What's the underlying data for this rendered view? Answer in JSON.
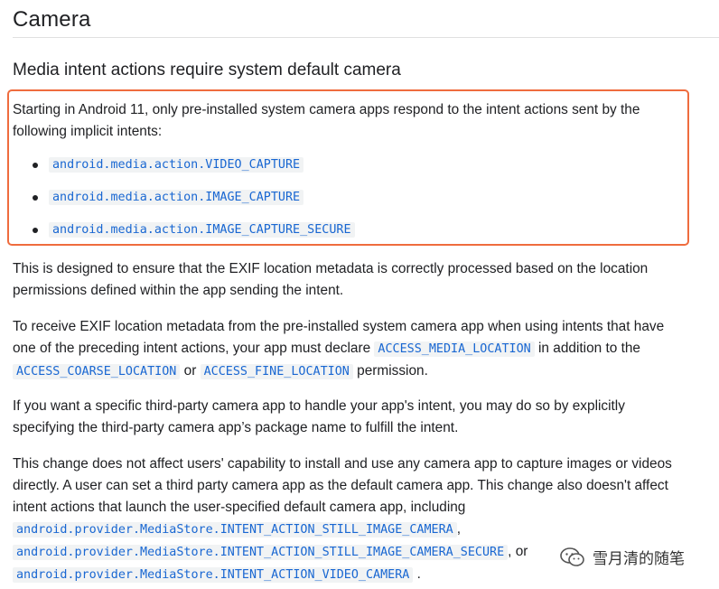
{
  "page_title": "Camera",
  "section_heading": "Media intent actions require system default camera",
  "intro": "Starting in Android 11, only pre-installed system camera apps respond to the intent actions sent by the",
  "intro_line2": "following implicit intents:",
  "intent_list": [
    "android.media.action.VIDEO_CAPTURE",
    "android.media.action.IMAGE_CAPTURE",
    "android.media.action.IMAGE_CAPTURE_SECURE"
  ],
  "p_exif": {
    "line1": "This is designed to ensure that the EXIF location metadata is correctly processed based on the location",
    "line2": "permissions defined within the app sending the intent."
  },
  "p_receive": {
    "line1": "To receive EXIF location metadata from the pre-installed system camera app when using intents that have",
    "line2_pre": "one of the preceding intent actions, your app must declare",
    "code_media_location": "ACCESS_MEDIA_LOCATION",
    "line2_post": "in addition to the",
    "code_coarse": "ACCESS_COARSE_LOCATION",
    "or": "or",
    "code_fine": "ACCESS_FINE_LOCATION",
    "line3_post": "permission."
  },
  "p_third_party": {
    "line1": "If you want a specific third-party camera app to handle your app's intent, you may do so by explicitly",
    "line2": "specifying the third-party camera app’s package name to fulfill the intent."
  },
  "p_change": {
    "line1": "This change does not affect users' capability to install and use any camera app to capture images or videos",
    "line2": "directly. A user can set a third party camera app as the default camera app. This change also doesn't affect",
    "line3": "intent actions that launch the user-specified default camera app, including",
    "code1": "android.provider.MediaStore.INTENT_ACTION_STILL_IMAGE_CAMERA",
    "comma": ",",
    "code2": "android.provider.MediaStore.INTENT_ACTION_STILL_IMAGE_CAMERA_SECURE",
    "or": ", or",
    "code3": "android.provider.MediaStore.INTENT_ACTION_VIDEO_CAMERA",
    "period": "."
  },
  "watermark": {
    "text": "雪月清的随笔",
    "icon": "wechat-icon"
  },
  "colors": {
    "highlight_border": "#ef6c3e",
    "code_text": "#1967d2",
    "code_bg": "#f1f3f4"
  }
}
